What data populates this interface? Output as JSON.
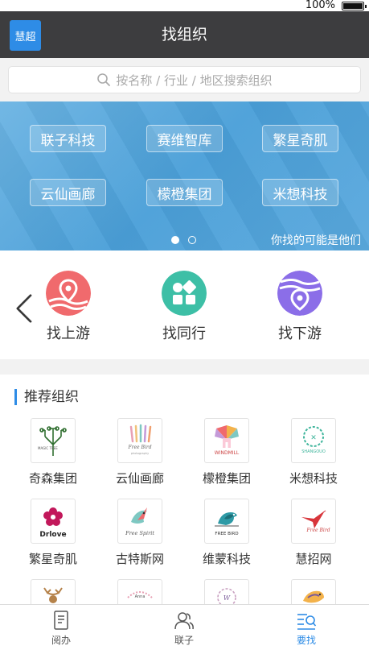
{
  "status": {
    "battery": "100%"
  },
  "nav": {
    "avatar": "慧超",
    "title": "找组织"
  },
  "search": {
    "placeholder": "按名称 / 行业 / 地区搜索组织"
  },
  "banner": {
    "chips": [
      "联子科技",
      "赛维智库",
      "繁星奇肌",
      "云仙画廊",
      "檬橙集团",
      "米想科技"
    ],
    "caption": "你找的可能是他们",
    "page_count": 2,
    "active_page": 1
  },
  "quick": [
    {
      "label": "找上游",
      "icon": "location-pin-icon",
      "color": "#f06a6d"
    },
    {
      "label": "找同行",
      "icon": "apps-grid-icon",
      "color": "#3dbfa6"
    },
    {
      "label": "找下游",
      "icon": "location-pin-icon",
      "color": "#8b6ee8"
    }
  ],
  "recommend": {
    "title": "推荐组织",
    "orgs": [
      {
        "name": "奇森集团",
        "logo_text": "MAGIC TREE"
      },
      {
        "name": "云仙画廊",
        "logo_text": "Free Bird"
      },
      {
        "name": "檬橙集团",
        "logo_text": "WINDMILL"
      },
      {
        "name": "米想科技",
        "logo_text": "SHANGOUO"
      },
      {
        "name": "繁星奇肌",
        "logo_text": "Drlove"
      },
      {
        "name": "古特斯网",
        "logo_text": "Free Spirit"
      },
      {
        "name": "维蒙科技",
        "logo_text": "FREE BIRD"
      },
      {
        "name": "慧招网",
        "logo_text": "Free Bird"
      }
    ]
  },
  "tabs": [
    {
      "label": "阅办",
      "icon": "document-icon"
    },
    {
      "label": "联子",
      "icon": "contacts-icon"
    },
    {
      "label": "要找",
      "icon": "search-list-icon",
      "active": true
    }
  ]
}
